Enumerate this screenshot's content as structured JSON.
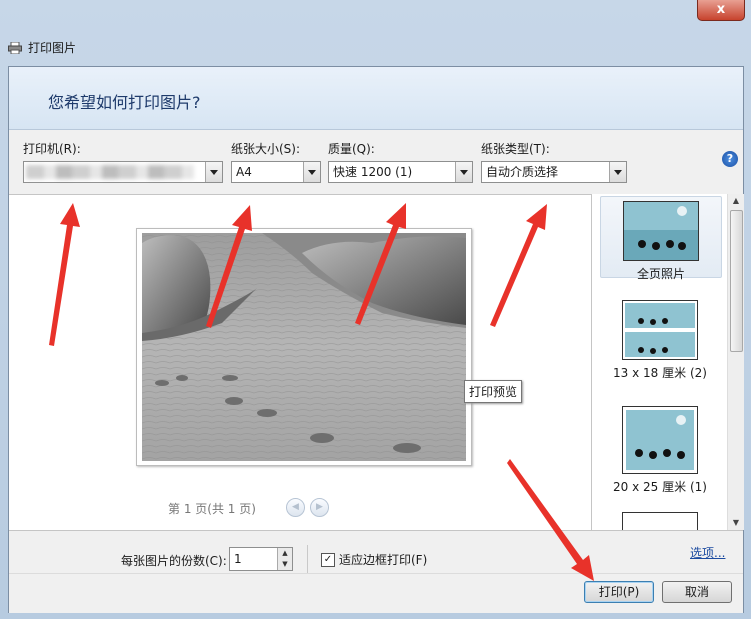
{
  "window": {
    "close_label": "x"
  },
  "dialog": {
    "title": "打印图片",
    "header": "您希望如何打印图片?"
  },
  "options": {
    "printer_label": "打印机(R):",
    "paper_size_label": "纸张大小(S):",
    "paper_size_value": "A4",
    "quality_label": "质量(Q):",
    "quality_value": "快速 1200 (1)",
    "paper_type_label": "纸张类型(T):",
    "paper_type_value": "自动介质选择",
    "help_label": "?"
  },
  "preview": {
    "tooltip": "打印预览",
    "pager_text": "第 1 页(共 1 页)"
  },
  "layouts": [
    {
      "label": "全页照片"
    },
    {
      "label": "13 x 18 厘米 (2)"
    },
    {
      "label": "20 x 25 厘米 (1)"
    }
  ],
  "bottom": {
    "copies_label": "每张图片的份数(C):",
    "copies_value": "1",
    "fit_label": "适应边框打印(F)",
    "options_link": "选项...",
    "print_button": "打印(P)",
    "cancel_button": "取消"
  },
  "colors": {
    "accent": "#1e3a6b",
    "arrow": "#e8322a"
  }
}
